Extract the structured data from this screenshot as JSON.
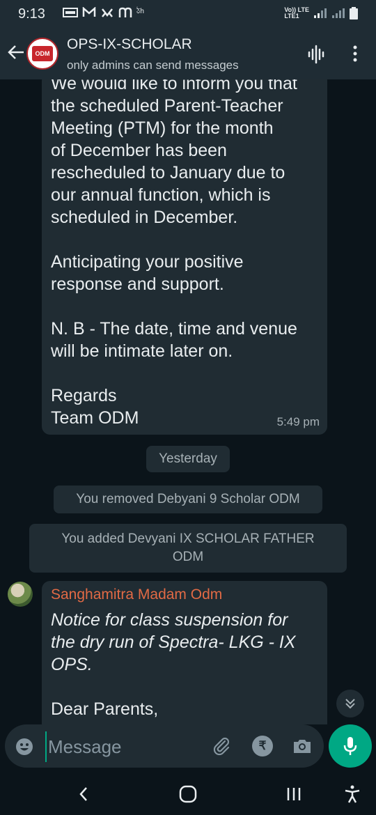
{
  "status_bar": {
    "time": "9:13",
    "network": "Vo)) LTE\nLTE1"
  },
  "header": {
    "title": "OPS-IX-SCHOLAR",
    "subtitle": "only admins can send messages",
    "avatar_text": "ODM"
  },
  "messages": [
    {
      "text": "We would like to inform you that\nthe scheduled Parent-Teacher\nMeeting (PTM) for the month\nof December has been\nrescheduled to January due to\nour annual function, which is\nscheduled in December.\n\nAnticipating your positive\nresponse and support.\n\nN. B - The date, time and venue\nwill be intimate later on.\n\nRegards\nTeam ODM",
      "time": "5:49 pm"
    },
    {
      "sender": "Sanghamitra Madam Odm",
      "italic_text": "Notice for class suspension for\nthe dry run of Spectra- LKG - IX\nOPS.",
      "text": "Dear Parents,"
    }
  ],
  "date_divider": "Yesterday",
  "system_messages": [
    "You removed Debyani 9 Scholar ODM",
    "You added Devyani IX SCHOLAR FATHER\nODM"
  ],
  "input": {
    "placeholder": "Message",
    "rupee_symbol": "₹"
  },
  "colors": {
    "accent": "#00a884",
    "bubble": "#202c33",
    "header": "#1f2c34",
    "sender_name": "#e26a45"
  }
}
